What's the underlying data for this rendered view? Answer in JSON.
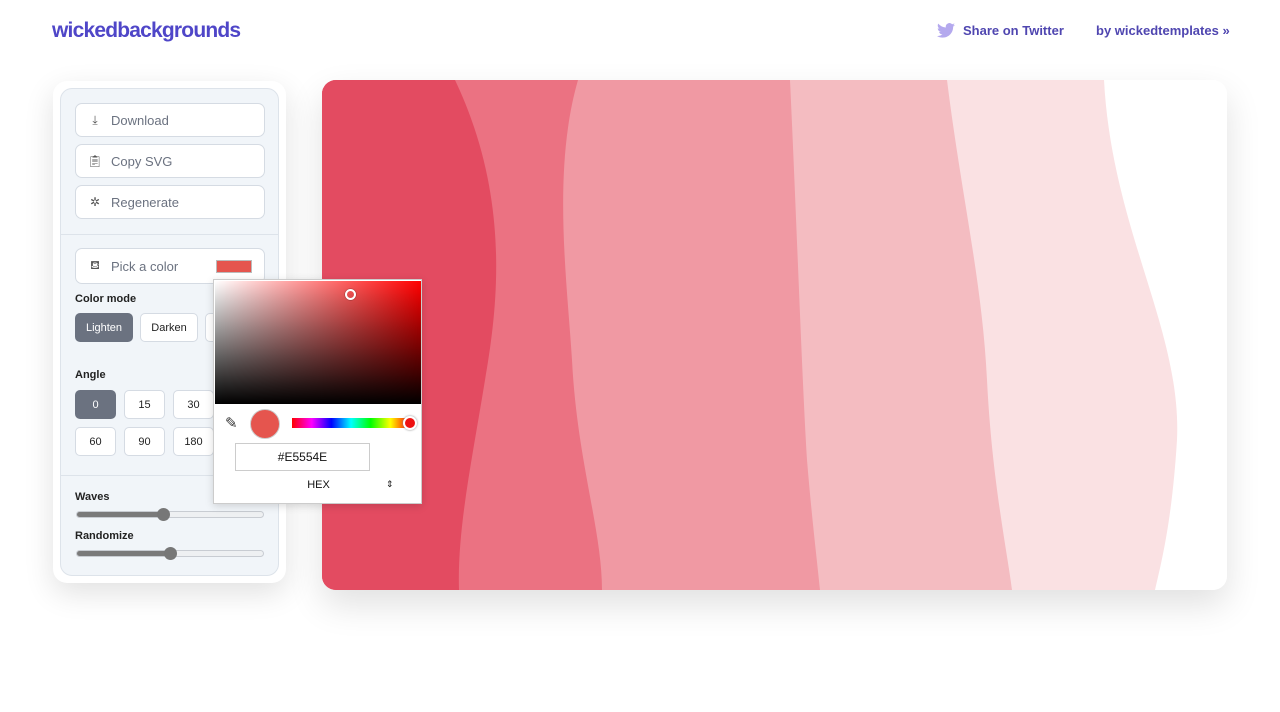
{
  "header": {
    "logo": "wickedbackgrounds",
    "share": "Share on Twitter",
    "by": "by wickedtemplates »"
  },
  "panel": {
    "download": "Download",
    "copy_svg": "Copy SVG",
    "regenerate": "Regenerate",
    "pick_color": "Pick a color",
    "swatch_color": "#E5554E",
    "color_mode_label": "Color mode",
    "color_modes": [
      "Lighten",
      "Darken"
    ],
    "color_mode_selected": "Lighten",
    "angle_label": "Angle",
    "angles": [
      "0",
      "15",
      "30",
      "60",
      "90",
      "180"
    ],
    "angle_selected": "0",
    "waves_label": "Waves",
    "waves_value_pct": 46,
    "randomize_label": "Randomize",
    "randomize_value_pct": 50
  },
  "picker": {
    "hex": "#E5554E",
    "format": "HEX",
    "hue_pct": 100
  },
  "wave_colors": [
    "#E34B61",
    "#EB7282",
    "#F099A3",
    "#F4BCC1",
    "#FAE1E3",
    "#FFFFFF"
  ],
  "accent": "#4F46C8"
}
